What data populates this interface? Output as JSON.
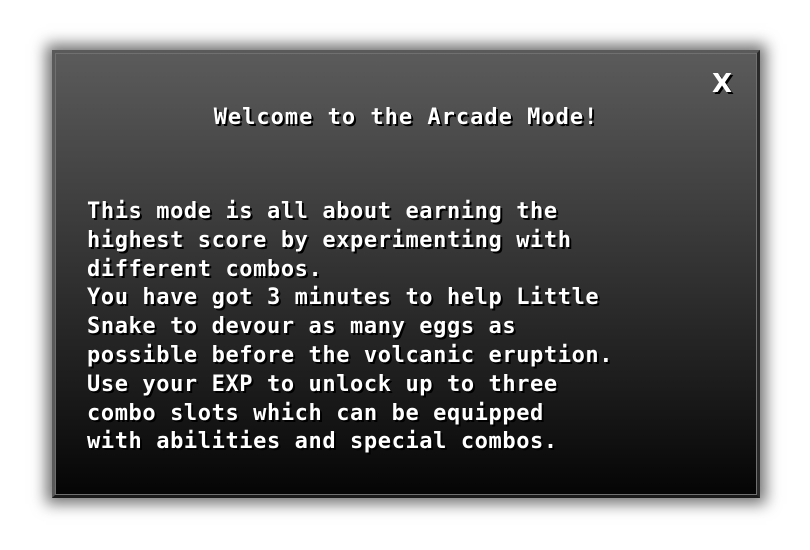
{
  "dialog": {
    "close_label": "X",
    "title": "Welcome to the Arcade Mode!",
    "lines": [
      "This mode is all about earning the",
      "highest score by experimenting with",
      "different combos.",
      "You have got 3 minutes to help Little",
      "Snake to devour as many eggs as",
      "possible before the volcanic eruption.",
      "Use your EXP to unlock up to three",
      "combo slots which can be equipped",
      "with abilities and special combos."
    ]
  },
  "colors": {
    "text": "#ffffff",
    "panel_top": "#5b5b5b",
    "panel_bottom": "#050505",
    "shadow": "#000000"
  }
}
